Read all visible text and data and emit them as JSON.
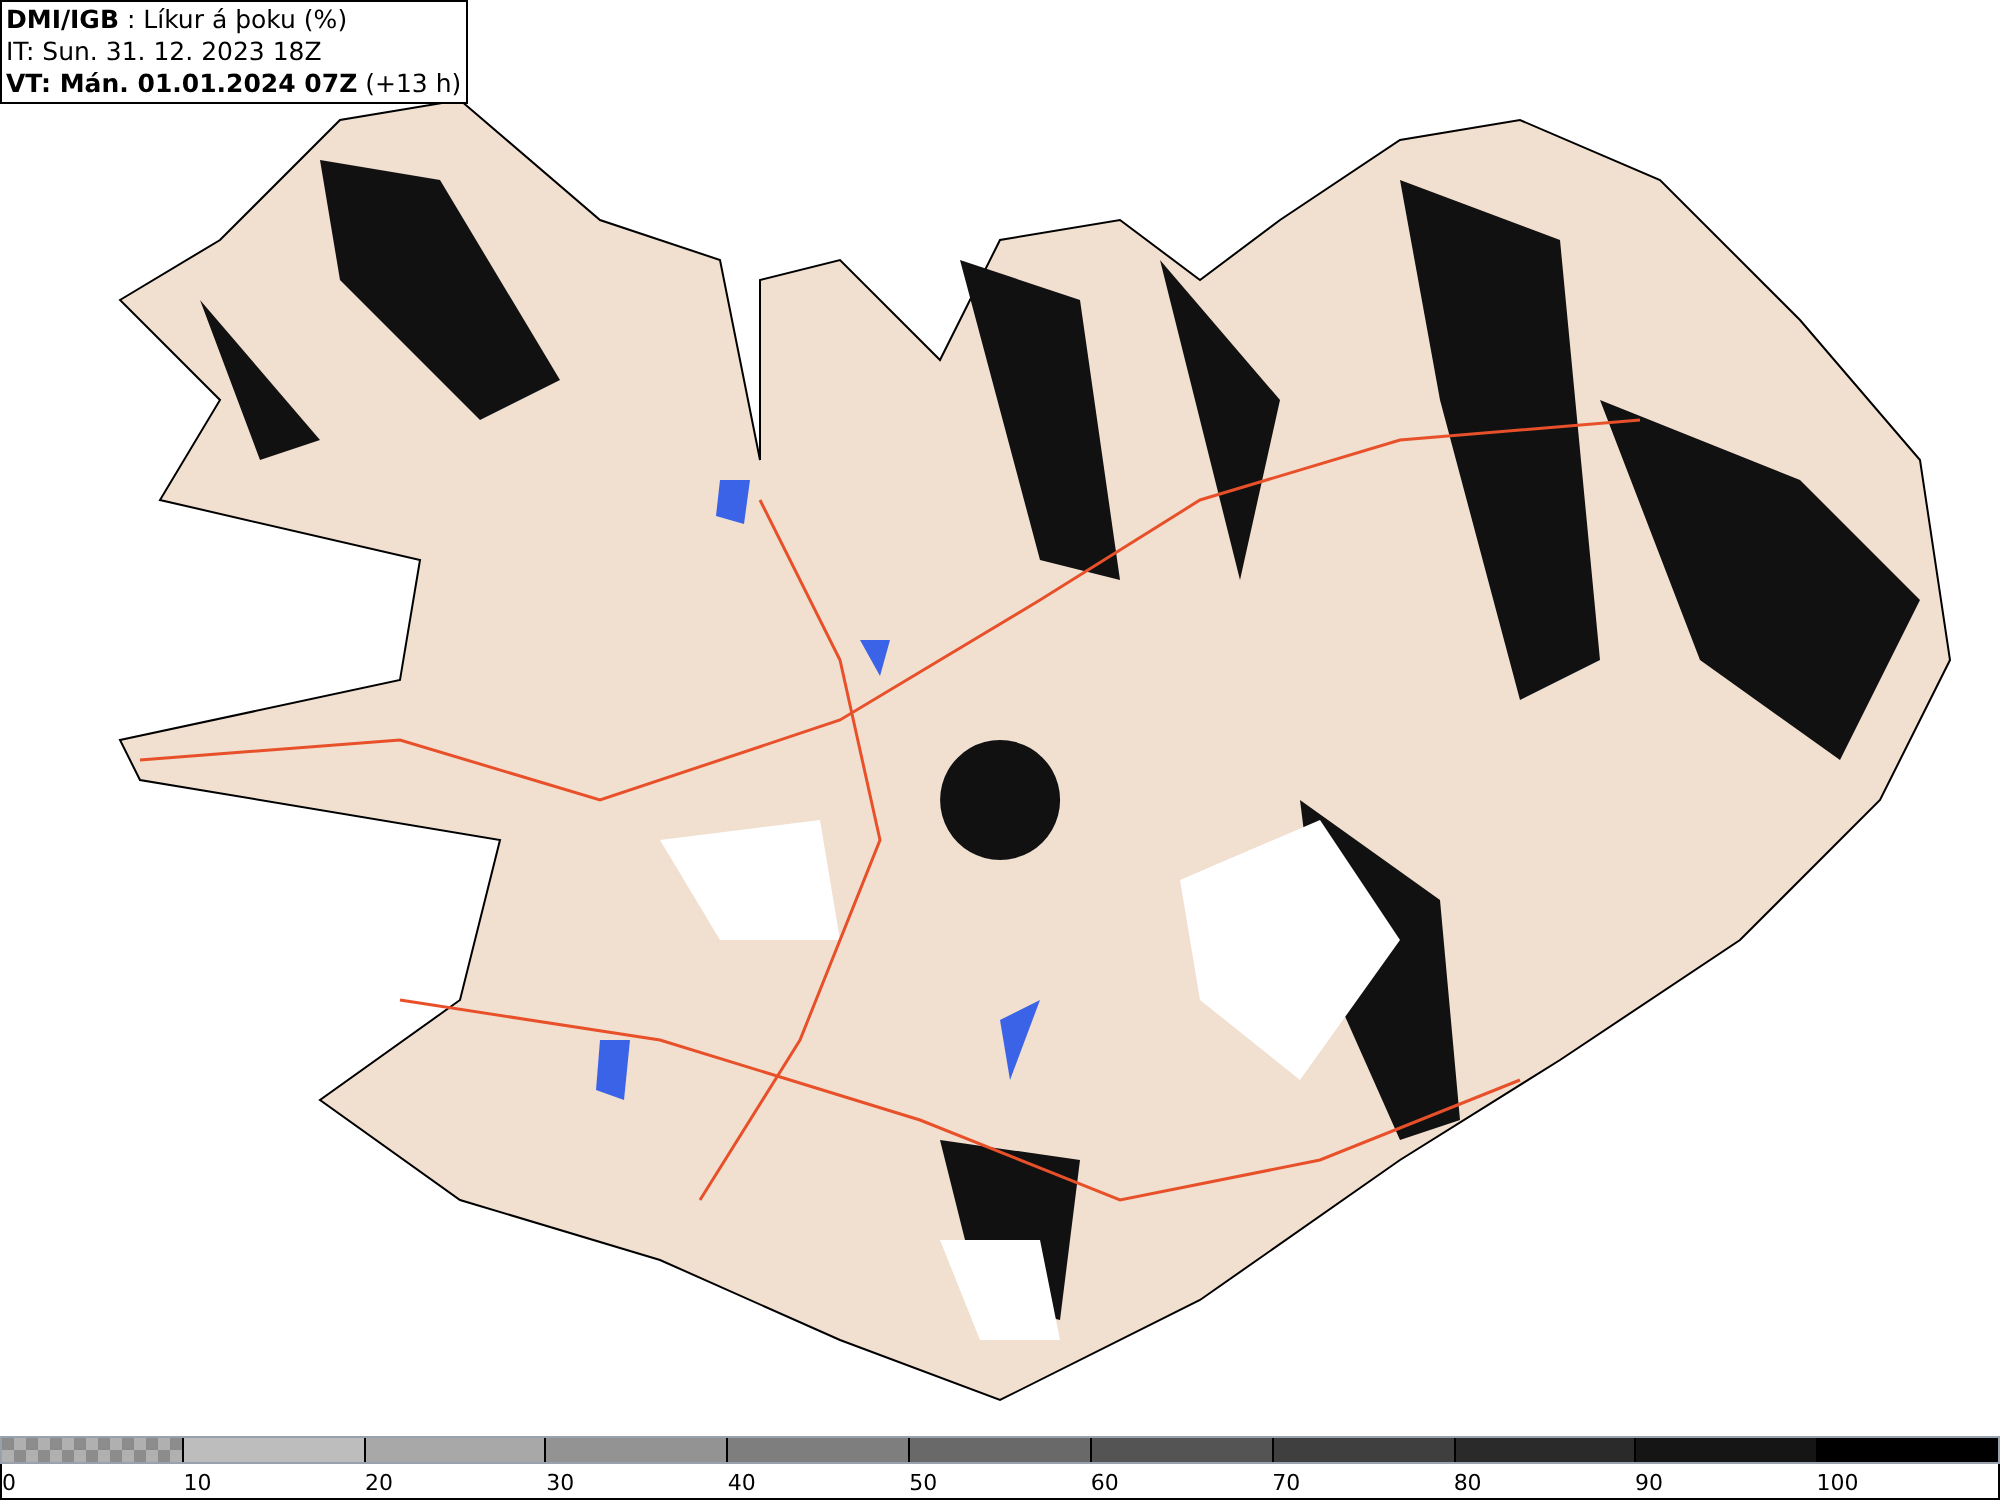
{
  "header": {
    "lines": [
      "**DMI/IGB** : Líkur á þoku (%)",
      "IT: Sun. 31. 12. 2023 18Z",
      "**VT: Mán. 01.01.2024 07Z** (+13 h)"
    ]
  },
  "legend": {
    "segments": [
      {
        "kind": "checkered",
        "color": "#8c8c8c"
      },
      {
        "kind": "solid",
        "color": "#bdbdbd"
      },
      {
        "kind": "solid",
        "color": "#a8a8a8"
      },
      {
        "kind": "solid",
        "color": "#939393"
      },
      {
        "kind": "solid",
        "color": "#7e7e7e"
      },
      {
        "kind": "solid",
        "color": "#696969"
      },
      {
        "kind": "solid",
        "color": "#545454"
      },
      {
        "kind": "solid",
        "color": "#3f3f3f"
      },
      {
        "kind": "solid",
        "color": "#2a2a2a"
      },
      {
        "kind": "solid",
        "color": "#151515"
      },
      {
        "kind": "solid",
        "color": "#000000"
      }
    ],
    "labels": [
      "0",
      "10",
      "20",
      "30",
      "40",
      "50",
      "60",
      "70",
      "80",
      "90",
      "100"
    ]
  }
}
